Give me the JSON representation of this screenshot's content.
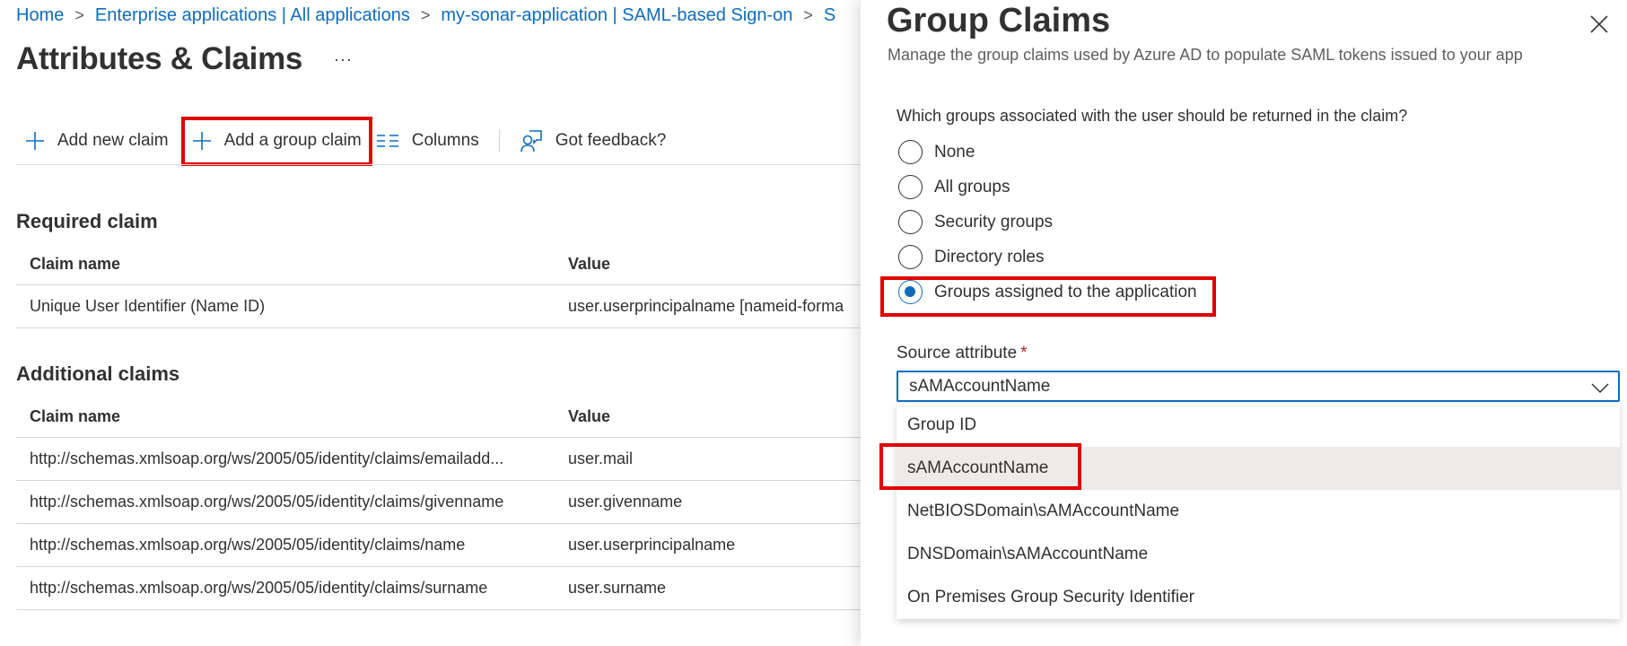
{
  "breadcrumb": [
    {
      "label": "Home"
    },
    {
      "label": "Enterprise applications | All applications"
    },
    {
      "label": "my-sonar-application | SAML-based Sign-on"
    },
    {
      "label": "S"
    }
  ],
  "page": {
    "title": "Attributes & Claims",
    "more_label": "···"
  },
  "toolbar": {
    "add_new_claim": "Add new claim",
    "add_group_claim": "Add a group claim",
    "columns": "Columns",
    "feedback": "Got feedback?"
  },
  "required": {
    "title": "Required claim",
    "headers": {
      "name": "Claim name",
      "value": "Value"
    },
    "rows": [
      {
        "name": "Unique User Identifier (Name ID)",
        "value": "user.userprincipalname [nameid-forma"
      }
    ]
  },
  "additional": {
    "title": "Additional claims",
    "headers": {
      "name": "Claim name",
      "value": "Value"
    },
    "rows": [
      {
        "name": "http://schemas.xmlsoap.org/ws/2005/05/identity/claims/emailadd...",
        "value": "user.mail"
      },
      {
        "name": "http://schemas.xmlsoap.org/ws/2005/05/identity/claims/givenname",
        "value": "user.givenname"
      },
      {
        "name": "http://schemas.xmlsoap.org/ws/2005/05/identity/claims/name",
        "value": "user.userprincipalname"
      },
      {
        "name": "http://schemas.xmlsoap.org/ws/2005/05/identity/claims/surname",
        "value": "user.surname"
      }
    ]
  },
  "panel": {
    "title": "Group Claims",
    "subtitle": "Manage the group claims used by Azure AD to populate SAML tokens issued to your app",
    "question": "Which groups associated with the user should be returned in the claim?",
    "options": [
      {
        "label": "None",
        "checked": false
      },
      {
        "label": "All groups",
        "checked": false
      },
      {
        "label": "Security groups",
        "checked": false
      },
      {
        "label": "Directory roles",
        "checked": false
      },
      {
        "label": "Groups assigned to the application",
        "checked": true
      }
    ],
    "source_attribute": {
      "label": "Source attribute",
      "required_mark": "*",
      "value": "sAMAccountName",
      "options": [
        {
          "label": "Group ID",
          "selected": false
        },
        {
          "label": "sAMAccountName",
          "selected": true
        },
        {
          "label": "NetBIOSDomain\\sAMAccountName",
          "selected": false
        },
        {
          "label": "DNSDomain\\sAMAccountName",
          "selected": false
        },
        {
          "label": "On Premises Group Security Identifier",
          "selected": false
        }
      ]
    }
  },
  "colors": {
    "accent": "#0f6cbd",
    "highlight_box": "#e00000",
    "text": "#323130",
    "required": "#a4262c"
  }
}
